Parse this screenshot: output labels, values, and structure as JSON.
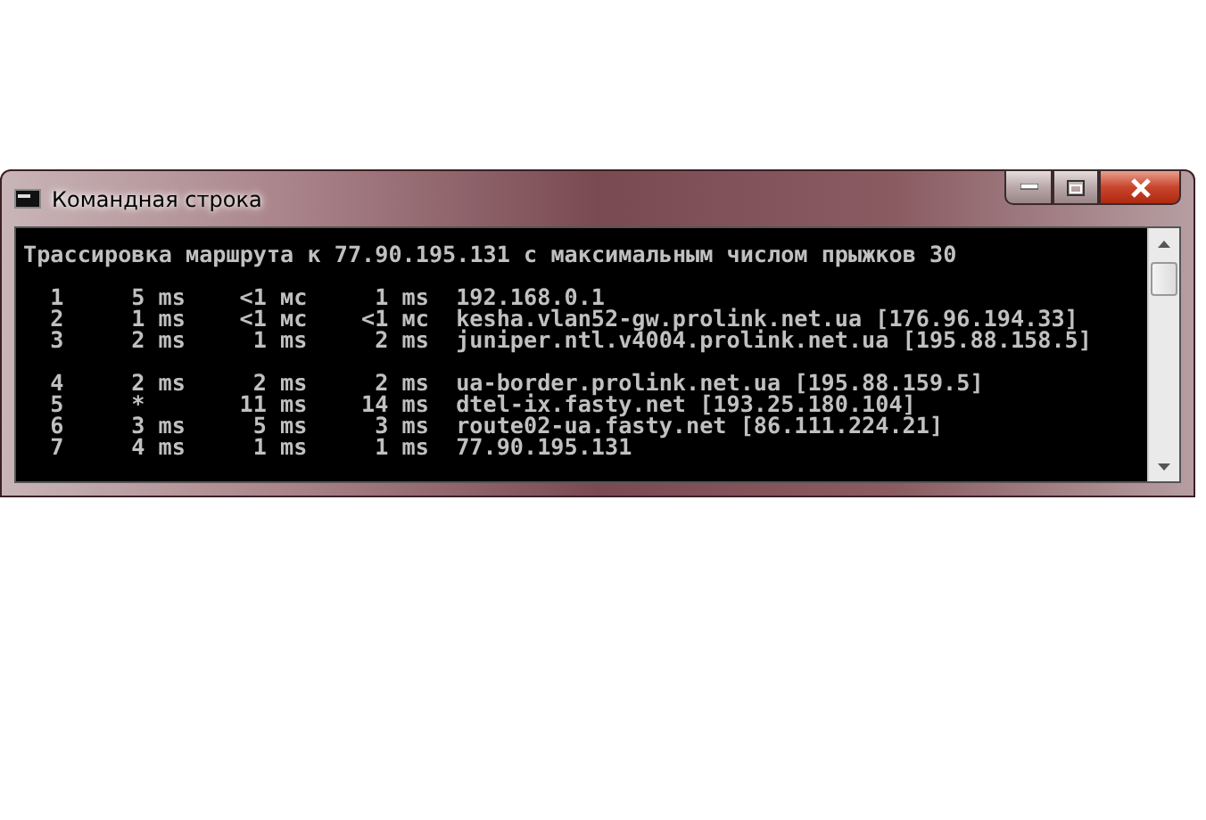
{
  "window": {
    "title": "Командная строка"
  },
  "console": {
    "heading": "Трассировка маршрута к 77.90.195.131 с максимальным числом прыжков 30",
    "blocks": [
      {
        "rows": [
          {
            "hop": "1",
            "t1": "5 ms",
            "t2": "<1 мс",
            "t3": "1 ms",
            "host": "192.168.0.1"
          },
          {
            "hop": "2",
            "t1": "1 ms",
            "t2": "<1 мс",
            "t3": "<1 мс",
            "host": "kesha.vlan52-gw.prolink.net.ua [176.96.194.33]"
          },
          {
            "hop": "3",
            "t1": "2 ms",
            "t2": "1 ms",
            "t3": "2 ms",
            "host": "juniper.ntl.v4004.prolink.net.ua [195.88.158.5]"
          }
        ]
      },
      {
        "rows": [
          {
            "hop": "4",
            "t1": "2 ms",
            "t2": "2 ms",
            "t3": "2 ms",
            "host": "ua-border.prolink.net.ua [195.88.159.5]"
          },
          {
            "hop": "5",
            "t1": "*",
            "t2": "11 ms",
            "t3": "14 ms",
            "host": "dtel-ix.fasty.net [193.25.180.104]"
          },
          {
            "hop": "6",
            "t1": "3 ms",
            "t2": "5 ms",
            "t3": "3 ms",
            "host": "route02-ua.fasty.net [86.111.224.21]"
          },
          {
            "hop": "7",
            "t1": "4 ms",
            "t2": "1 ms",
            "t3": "1 ms",
            "host": "77.90.195.131"
          }
        ]
      }
    ]
  }
}
